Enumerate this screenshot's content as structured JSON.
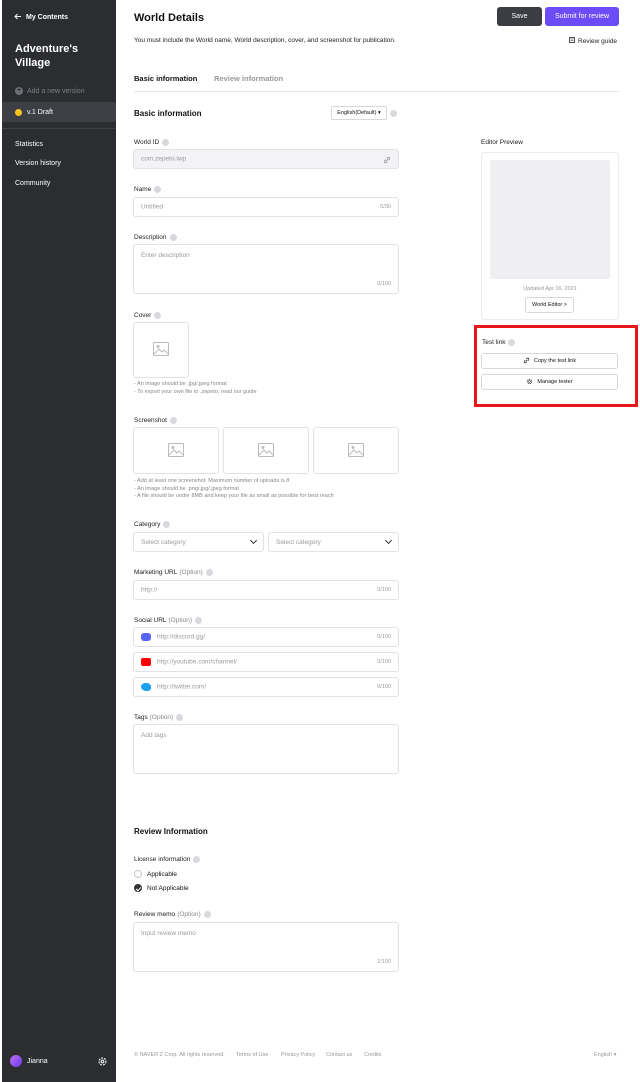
{
  "sidebar": {
    "back_label": "My Contents",
    "project_title": "Adventure's Village",
    "add_version": "Add a new version",
    "draft_label": "v.1 Draft",
    "nav": [
      "Statistics",
      "Version history",
      "Community"
    ],
    "user_name": "Jianna"
  },
  "header": {
    "title": "World Details",
    "save_label": "Save",
    "submit_label": "Submit for review",
    "intro": "You must include the World name, World description, cover, and screenshot for publication.",
    "guide_label": "Review guide"
  },
  "tabs": [
    "Basic information",
    "Review information"
  ],
  "basic": {
    "section_title": "Basic information",
    "language": "English(Default) ▾",
    "world_id": {
      "label": "World ID",
      "value": "com.zepeto.iwp"
    },
    "name": {
      "label": "Name",
      "placeholder": "Untitled",
      "counter": "0/30"
    },
    "description": {
      "label": "Description",
      "placeholder": "Enter description",
      "counter": "0/100"
    },
    "cover": {
      "label": "Cover",
      "notes": [
        "- An image should be .jpg/.jpeg format",
        "- To export your own file to .zepeto, read our guide"
      ]
    },
    "screenshot": {
      "label": "Screenshot",
      "notes": [
        "- Add at least one screenshot. Maximum number of uploads is 8",
        "- An image should be .png/.jpg/.jpeg format",
        "- A file should be under 8MB and keep your file as small as possible for best reach"
      ]
    },
    "category": {
      "label": "Category",
      "select1": "Select category",
      "select2": "Select category"
    },
    "marketing": {
      "label": "Marketing URL",
      "opt": "(Option)",
      "placeholder": "http://",
      "counter": "0/100"
    },
    "social": {
      "label": "Social URL",
      "opt": "(Option)",
      "items": [
        {
          "placeholder": "http://discord.gg/",
          "counter": "0/100"
        },
        {
          "placeholder": "http://youtube.com/channel/",
          "counter": "0/100"
        },
        {
          "placeholder": "http://twitter.com/",
          "counter": "0/100"
        }
      ]
    },
    "tags": {
      "label": "Tags",
      "opt": "(Option)",
      "placeholder": "Add tags"
    }
  },
  "preview": {
    "label": "Editor Preview",
    "updated": "Updated Apr 16, 2021",
    "editor_button": "World Editor >",
    "test_link_label": "Test link",
    "copy_button": "Copy the test link",
    "manage_button": "Manage tester"
  },
  "review": {
    "section_title": "Review Information",
    "license_label": "License information",
    "options": [
      "Applicable",
      "Not Applicable"
    ],
    "selected": "Not Applicable",
    "memo_label": "Review memo",
    "memo_opt": "(Option)",
    "memo_placeholder": "Input review memo",
    "memo_counter": "1/100"
  },
  "footer": {
    "copyright": "© NAVER Z Corp. All rights reserved.",
    "links": [
      "Terms of Use",
      "Privacy Policy",
      "Contact us",
      "Credits"
    ],
    "language": "English ▾"
  },
  "colors": {
    "accent": "#6c4cf6",
    "sidebar": "#2b2d31",
    "highlight": "#e8171b",
    "draft_dot": "#f8c51c"
  }
}
